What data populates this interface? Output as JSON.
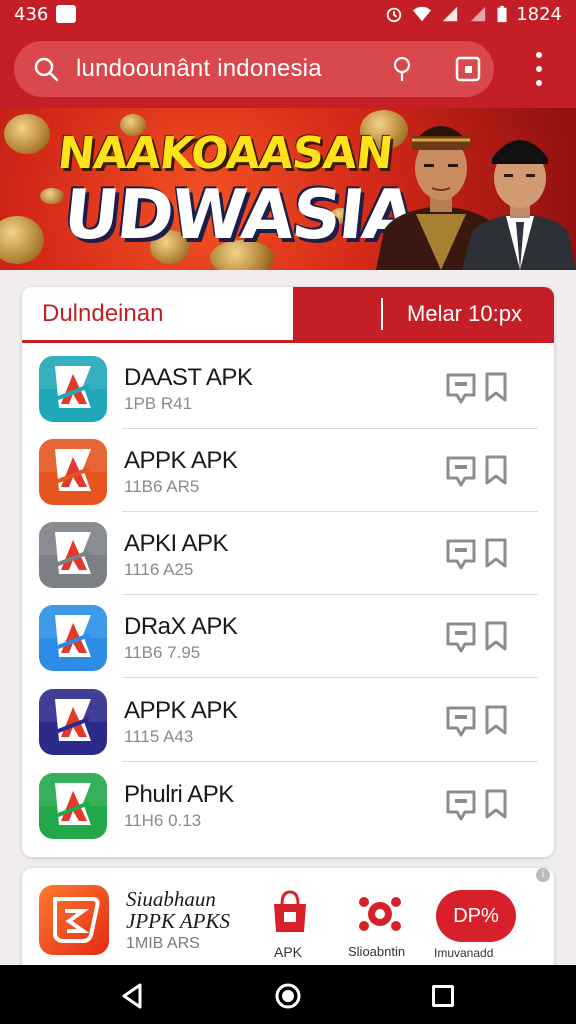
{
  "status_bar": {
    "time": "436",
    "clock": "1824"
  },
  "search": {
    "value": "lundoounânt indonesia"
  },
  "banner": {
    "line1": "NAAKOAASAN",
    "line2": "UDWASIA"
  },
  "tabs": {
    "left_label": "Dulndeinan",
    "right_label": "Melar 10:px"
  },
  "apps": [
    {
      "name": "DAAST APK",
      "meta": "1PB R41",
      "icon_color": "#1fa8b8",
      "icon_caption": "ALOO"
    },
    {
      "name": "APPK APK",
      "meta": "11B6 AR5",
      "icon_color": "#e6551f",
      "icon_caption": ""
    },
    {
      "name": "APKI APK",
      "meta": "1116 A25",
      "icon_color": "#7c7f85",
      "icon_caption": ""
    },
    {
      "name": "DRaX APK",
      "meta": "11B6 7.95",
      "icon_color": "#2b8de6",
      "icon_caption": "ALOO"
    },
    {
      "name": "APPK APK",
      "meta": "1115 A43",
      "icon_color": "#2c2a8a",
      "icon_caption": ""
    },
    {
      "name": "Phulri APK",
      "meta": "11H6 0.13",
      "icon_color": "#21a84a",
      "icon_caption": "Ahnr"
    }
  ],
  "promo": {
    "name_line1": "Siuabhaun",
    "name_line2": "JPPK APKS",
    "meta": "1MIB ARS",
    "bag_label": "APK",
    "net_label": "Slioabntin",
    "dp_label": "DP%",
    "dp_caption": "Imuvanadd"
  },
  "colors": {
    "brand_red": "#c41f26",
    "nav_black": "#000000"
  }
}
